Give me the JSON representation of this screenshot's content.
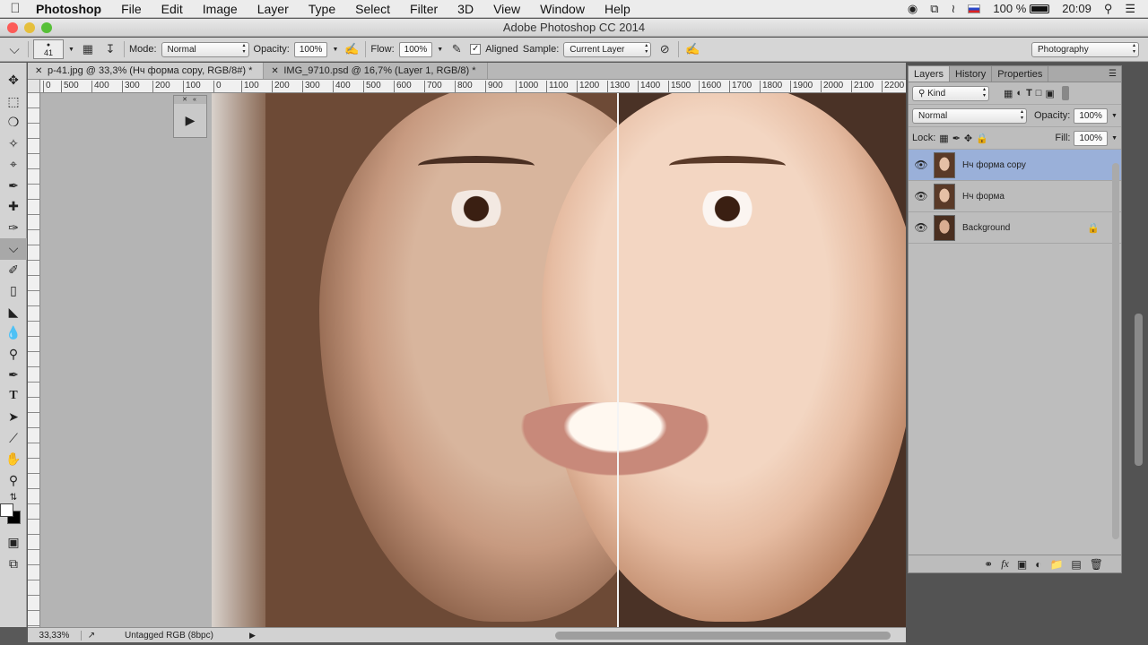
{
  "menubar": {
    "app": "Photoshop",
    "items": [
      "File",
      "Edit",
      "Image",
      "Layer",
      "Type",
      "Select",
      "Filter",
      "3D",
      "View",
      "Window",
      "Help"
    ],
    "battery": "100 %",
    "time": "20:09"
  },
  "window": {
    "title": "Adobe Photoshop CC 2014"
  },
  "options": {
    "brush_size": "41",
    "mode_label": "Mode:",
    "mode_value": "Normal",
    "opacity_label": "Opacity:",
    "opacity_value": "100%",
    "flow_label": "Flow:",
    "flow_value": "100%",
    "aligned_label": "Aligned",
    "aligned_checked": true,
    "sample_label": "Sample:",
    "sample_value": "Current Layer",
    "workspace": "Photography"
  },
  "tabs": [
    {
      "label": "p-41.jpg @ 33,3% (Нч форма copy, RGB/8#) *",
      "active": true
    },
    {
      "label": "IMG_9710.psd @ 16,7% (Layer 1, RGB/8) *",
      "active": false
    }
  ],
  "ruler": {
    "labels": [
      "0",
      "500",
      "400",
      "300",
      "200",
      "100",
      "0",
      "100",
      "200",
      "300",
      "400",
      "500",
      "600",
      "700",
      "800",
      "900",
      "1000",
      "1100",
      "1200",
      "1300",
      "1400",
      "1500",
      "1600",
      "1700",
      "1800",
      "1900",
      "2000",
      "2100",
      "2200"
    ]
  },
  "layers_panel": {
    "tabs": [
      "Layers",
      "History",
      "Properties"
    ],
    "filter_kind": "Kind",
    "blend_mode": "Normal",
    "opacity_label": "Opacity:",
    "opacity_value": "100%",
    "lock_label": "Lock:",
    "fill_label": "Fill:",
    "fill_value": "100%",
    "layers": [
      {
        "name": "Нч форма copy",
        "visible": true,
        "selected": true,
        "locked": false
      },
      {
        "name": "Нч форма",
        "visible": true,
        "selected": false,
        "locked": false
      },
      {
        "name": "Background",
        "visible": true,
        "selected": false,
        "locked": true
      }
    ]
  },
  "status": {
    "zoom": "33,33%",
    "profile": "Untagged RGB (8bpc)"
  }
}
